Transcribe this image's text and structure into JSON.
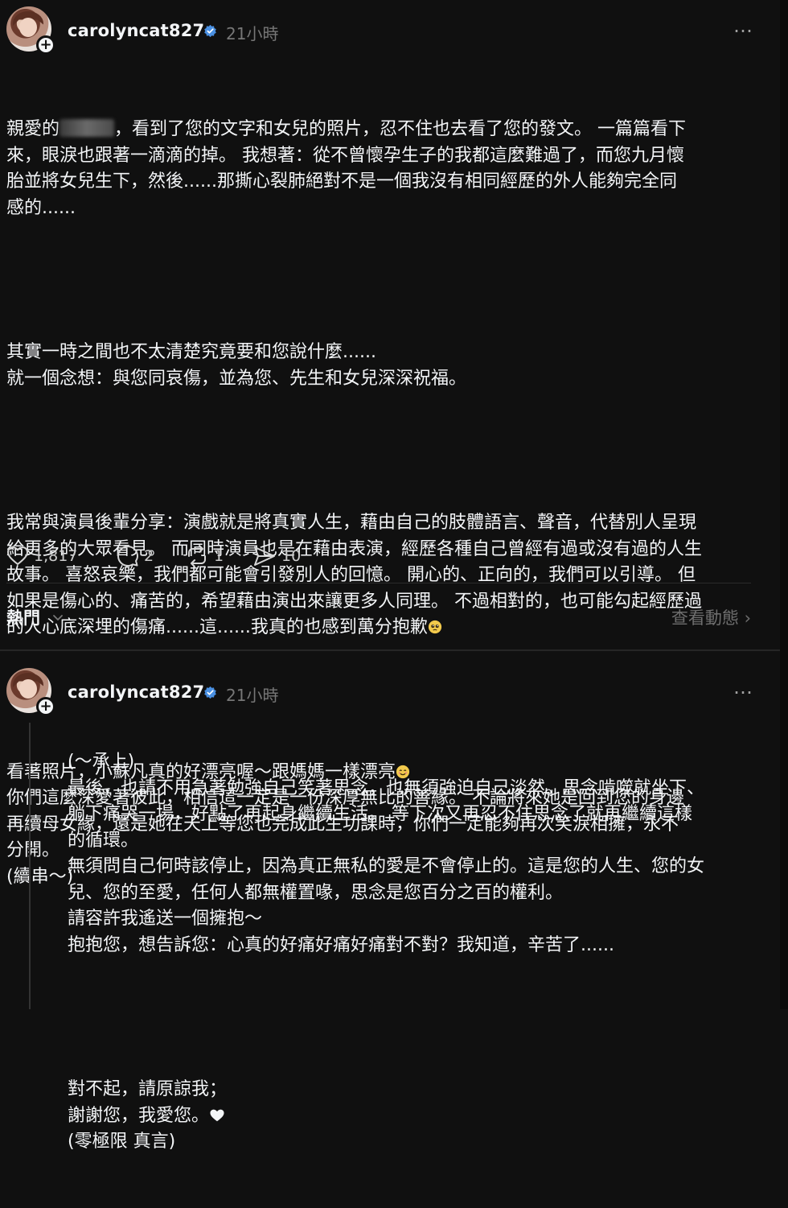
{
  "post1": {
    "username": "carolyncat827",
    "time": "21小時",
    "more_icon": "…",
    "paragraphs": [
      [
        "親愛的",
        "，看到了您的文字和女兒的照片，忍不住也去看了您的發文。 一篇篇看下",
        "來，眼淚也跟著一滴滴的掉。 我想著：從不曾懷孕生子的我都這麼難過了，而您九月懷",
        "胎並將女兒生下，然後......那撕心裂肺絕對不是一個我沒有相同經歷的外人能夠完全同",
        "感的......"
      ],
      [
        "其實一時之間也不太清楚究竟要和您說什麼......",
        "就一個念想：與您同哀傷，並為您、先生和女兒深深祝福。"
      ],
      [
        "我常與演員後輩分享：演戲就是將真實人生，藉由自己的肢體語言、聲音，代替別人呈現",
        "給更多的大眾看見。 而同時演員也是在藉由表演，經歷各種自己曾經有過或沒有過的人生",
        "故事。 喜怒哀樂，我們都可能會引發別人的回憶。 開心的、正向的，我們可以引導。 但",
        "如果是傷心的、痛苦的，希望藉由演出來讓更多人同理。 不過相對的，也可能勾起經歷過",
        "的人心底深埋的傷痛......這......我真的也感到萬分抱歉"
      ],
      [
        "看著照片，小蘇凡真的好漂亮喔～跟媽媽一樣漂亮",
        "你們這麼深愛著彼此，相信這一定是一份深厚無比的善緣。 不論將來她是回到您的身邊",
        "再續母女緣，還是她在天上等您也完成此生功課時，你們一定能夠再次笑淚相擁，永不",
        "分開。",
        "(續串～)"
      ]
    ],
    "actions": {
      "likes": "1,817",
      "comments": "2",
      "reposts": "1",
      "shares": "10"
    }
  },
  "hot_row": {
    "label": "熱門",
    "view_activity": "查看動態 ›"
  },
  "post2": {
    "username": "carolyncat827",
    "time": "21小時",
    "more_icon": "…",
    "paragraphs": [
      [
        "(～承上)",
        "最後，也請不用急著勉強自己笑著思念，也無須強迫自己淡然。思念啃噬就坐下、",
        "躺下痛哭一場，好點了再起身繼續生活。 等下次又再忍不住思念了就再繼續這樣",
        "的循環。",
        "無須問自己何時該停止，因為真正無私的愛是不會停止的。這是您的人生、您的女",
        "兒、您的至愛，任何人都無權置喙，思念是您百分之百的權利。",
        "請容許我遙送一個擁抱～",
        "抱抱您，想告訴您：心真的好痛好痛好痛對不對？我知道，辛苦了......"
      ],
      [
        "對不起，請原諒我；",
        "謝謝您，我愛您。",
        "(零極限 真言)"
      ]
    ]
  },
  "colors": {
    "background": "#101010",
    "text": "#f3f5f7",
    "muted": "#777777",
    "verified": "#4a90e2"
  }
}
